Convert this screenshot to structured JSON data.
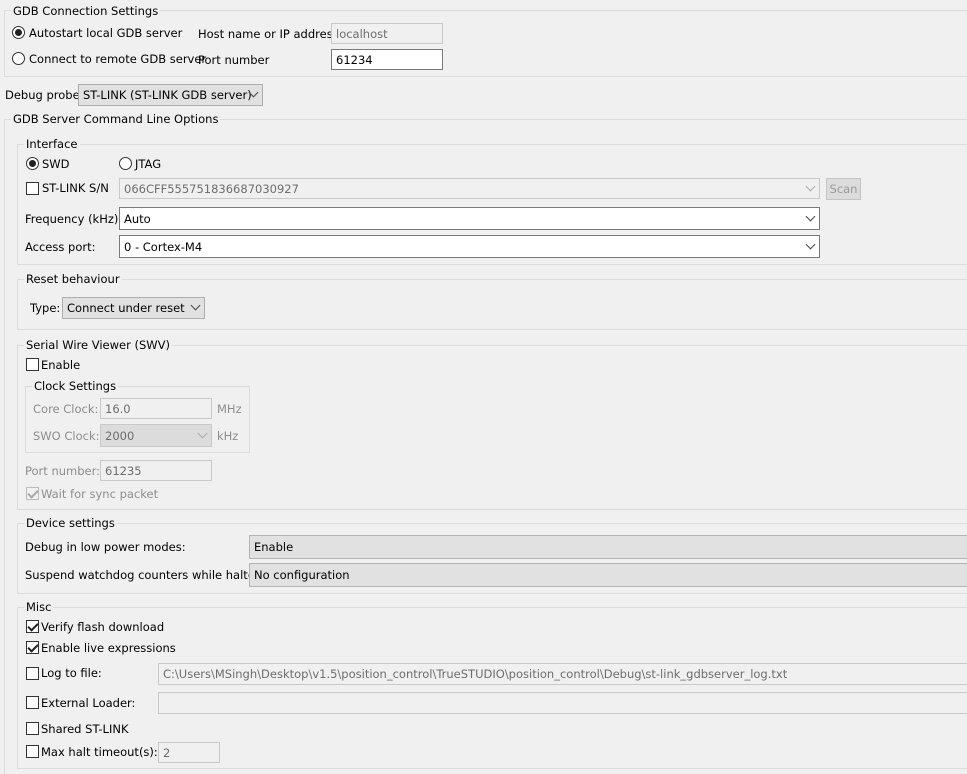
{
  "gdb_connection": {
    "title": "GDB Connection Settings",
    "autostart_label": "Autostart local GDB server",
    "remote_label": "Connect to remote GDB server",
    "host_label": "Host name or IP address",
    "host_value": "localhost",
    "port_label": "Port number",
    "port_value": "61234"
  },
  "debug_probe": {
    "label": "Debug probe",
    "value": "ST-LINK (ST-LINK GDB server)"
  },
  "server_options": {
    "title": "GDB Server Command Line Options"
  },
  "interface": {
    "title": "Interface",
    "swd_label": "SWD",
    "jtag_label": "JTAG",
    "stlink_sn_label": "ST-LINK S/N",
    "stlink_sn_value": "066CFF555751836687030927",
    "scan_label": "Scan",
    "frequency_label": "Frequency (kHz):",
    "frequency_value": "Auto",
    "access_port_label": "Access port:",
    "access_port_value": "0 - Cortex-M4"
  },
  "reset": {
    "title": "Reset behaviour",
    "type_label": "Type:",
    "type_value": "Connect under reset"
  },
  "swv": {
    "title": "Serial Wire Viewer (SWV)",
    "enable_label": "Enable",
    "clock_title": "Clock Settings",
    "core_clock_label": "Core Clock:",
    "core_clock_value": "16.0",
    "core_clock_unit": "MHz",
    "swo_clock_label": "SWO Clock:",
    "swo_clock_value": "2000",
    "swo_clock_unit": "kHz",
    "port_label": "Port number:",
    "port_value": "61235",
    "wait_sync_label": "Wait for sync packet"
  },
  "device": {
    "title": "Device settings",
    "low_power_label": "Debug in low power modes:",
    "low_power_value": "Enable",
    "watchdog_label": "Suspend watchdog counters while halted:",
    "watchdog_value": "No configuration"
  },
  "misc": {
    "title": "Misc",
    "verify_flash_label": "Verify flash download",
    "live_expr_label": "Enable live expressions",
    "log_file_label": "Log to file:",
    "log_file_value": "C:\\Users\\MSingh\\Desktop\\v1.5\\position_control\\TrueSTUDIO\\position_control\\Debug\\st-link_gdbserver_log.txt",
    "external_loader_label": "External Loader:",
    "external_loader_value": "",
    "shared_stlink_label": "Shared ST-LINK",
    "max_halt_label": "Max halt timeout(s):",
    "max_halt_value": "2"
  }
}
